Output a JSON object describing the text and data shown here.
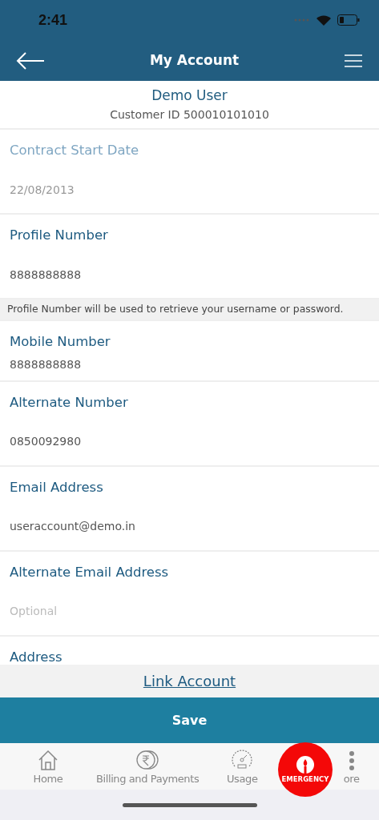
{
  "status_bar": {
    "time": "2:41"
  },
  "header": {
    "title": "My Account"
  },
  "user": {
    "name": "Demo User",
    "customer_id": "Customer ID 500010101010"
  },
  "fields": [
    {
      "label": "Contract Start Date",
      "value": "22/08/2013",
      "disabled": true,
      "kind": "spaced"
    },
    {
      "label": "Profile Number",
      "value": "8888888888",
      "disabled": false,
      "kind": "spaced",
      "note": "Profile Number will be used to retrieve your username or password."
    },
    {
      "label": "Mobile Number",
      "value": "8888888888",
      "disabled": false,
      "kind": "compact"
    },
    {
      "label": "Alternate Number",
      "value": "0850092980",
      "disabled": false,
      "kind": "spaced"
    },
    {
      "label": "Email Address",
      "value": "useraccount@demo.in",
      "disabled": false,
      "kind": "spaced"
    },
    {
      "label": "Alternate Email Address",
      "placeholder": "Optional",
      "disabled": false,
      "kind": "spaced"
    },
    {
      "label": "Address",
      "disabled": false,
      "kind": "spaced"
    }
  ],
  "link_account": "Link Account",
  "save_button": "Save",
  "tabs": [
    {
      "label": "Home"
    },
    {
      "label": "Billing and Payments"
    },
    {
      "label": "Usage"
    },
    {
      "label": "ore"
    }
  ],
  "emergency": "EMERGENCY"
}
